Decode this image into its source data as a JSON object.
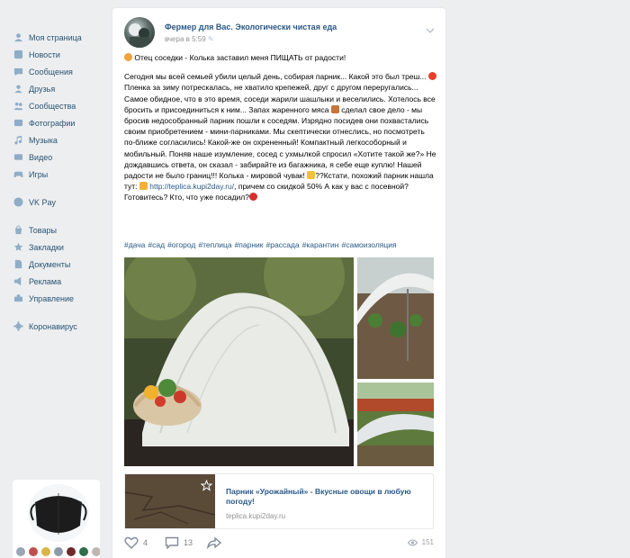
{
  "sidebar": {
    "items": [
      {
        "label": "Моя страница",
        "icon": "user-home-icon"
      },
      {
        "label": "Новости",
        "icon": "news-icon"
      },
      {
        "label": "Сообщения",
        "icon": "messages-icon"
      },
      {
        "label": "Друзья",
        "icon": "friends-icon"
      },
      {
        "label": "Сообщества",
        "icon": "communities-icon"
      },
      {
        "label": "Фотографии",
        "icon": "photos-icon"
      },
      {
        "label": "Музыка",
        "icon": "music-icon"
      },
      {
        "label": "Видео",
        "icon": "video-icon"
      },
      {
        "label": "Игры",
        "icon": "games-icon"
      }
    ],
    "pay": {
      "label": "VK Pay",
      "icon": "vkpay-icon"
    },
    "items2": [
      {
        "label": "Товары",
        "icon": "goods-icon"
      },
      {
        "label": "Закладки",
        "icon": "bookmarks-icon"
      },
      {
        "label": "Документы",
        "icon": "documents-icon"
      },
      {
        "label": "Реклама",
        "icon": "ads-icon"
      },
      {
        "label": "Управление",
        "icon": "manage-icon"
      }
    ],
    "covid": {
      "label": "Коронавирус",
      "icon": "coronavirus-icon"
    },
    "swatch_colors": [
      "#9aa6b4",
      "#c0504d",
      "#d9b44a",
      "#8a9aa8",
      "#6e2a2a",
      "#2f6e4a",
      "#c0b8b0"
    ]
  },
  "post": {
    "author": "Фермер для Вас. Экологически чистая еда",
    "time": "вчера в 5:59",
    "intro": "Отец соседки - Колька заставил меня ПИЩАТЬ от радости!",
    "body_1": "Сегодня мы всей семьей убили целый день, собирая парник... Какой это был треш...",
    "body_2": "Пленка за зиму потрескалась, не хватило крепежей, друг с другом переругались... Самое обидное, что в это время, соседи жарили шашлыки и веселились. Хотелось все бросить и присоединиться к ним... Запах жаренного мяса",
    "body_3": "сделал свое дело - мы бросив недособранный парник пошли к соседям. Изрядно посидев они похвастались своим приобретением - мини-парниками. Мы скептически отнеслись, но посмотреть по-ближе согласились! Какой-же он охрененный! Компактный легкособорный и мобильный. Поняв наше изумление, сосед с ухмылкой спросил «Хотите такой же?» Не дождавшись ответа, он сказал - забирайте из багажника, я себе еще куплю! Нашей радости не было границ!!! Колька - мировой чувак!",
    "body_4": "??Кстати, похожий парник нашла тут:",
    "link": "http://teplica.kupi2day.ru/",
    "body_5": ", причем со скидкой 50% А как у вас с посевной? Готовитесь? Кто, что уже посадил?",
    "tags": [
      "#дача",
      "#сад",
      "#огород",
      "#теплица",
      "#парник",
      "#рассада",
      "#карантин",
      "#самоизоляция"
    ],
    "snippet": {
      "title": "Парник «Урожайный» - Вкусные овощи в любую погоду!",
      "domain": "teplica.kupi2day.ru"
    },
    "likes": "4",
    "comments": "13",
    "views": "151"
  }
}
